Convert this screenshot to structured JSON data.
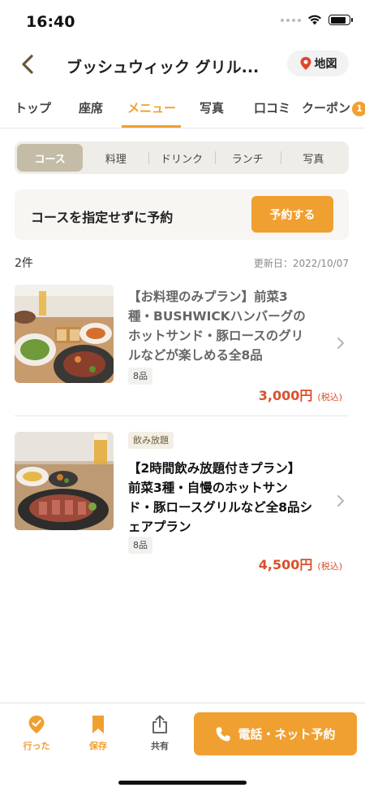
{
  "status_bar": {
    "time": "16:40"
  },
  "header": {
    "title": "ブッシュウィック グリル...",
    "map_label": "地図"
  },
  "tabs": [
    {
      "label": "トップ"
    },
    {
      "label": "座席"
    },
    {
      "label": "メニュー",
      "active": true
    },
    {
      "label": "写真"
    },
    {
      "label": "口コミ"
    },
    {
      "label": "クーポン",
      "badge": "1"
    }
  ],
  "segments": [
    {
      "label": "コース",
      "active": true
    },
    {
      "label": "料理"
    },
    {
      "label": "ドリンク"
    },
    {
      "label": "ランチ"
    },
    {
      "label": "写真"
    }
  ],
  "reserve": {
    "text": "コースを指定せずに予約",
    "button": "予約する"
  },
  "list_meta": {
    "count": "2件",
    "updated": "更新日：2022/10/07"
  },
  "courses": [
    {
      "title_lines": [
        "【お料理のみプラン】前菜3",
        "種・BUSHWICKハンバーグの",
        "ホットサンド・豚ロースのグリ",
        "ルなどが楽しめる全8品"
      ],
      "tag": "8品",
      "price": "3,000円",
      "tax": "(税込)"
    },
    {
      "label": "飲み放題",
      "title_lines": [
        "【2時間飲み放題付きプラン】",
        "前菜3種・自慢のホットサン",
        "ド・豚ロースグリルなど全8品シ",
        "ェアプラン"
      ],
      "tag": "8品",
      "price": "4,500円",
      "tax": "(税込)"
    }
  ],
  "bottom_bar": {
    "went": "行った",
    "save": "保存",
    "share": "共有",
    "call": "電話・ネット予約"
  },
  "colors": {
    "accent": "#f0a030",
    "price": "#d9502b",
    "segment_active": "#c4bca6"
  }
}
